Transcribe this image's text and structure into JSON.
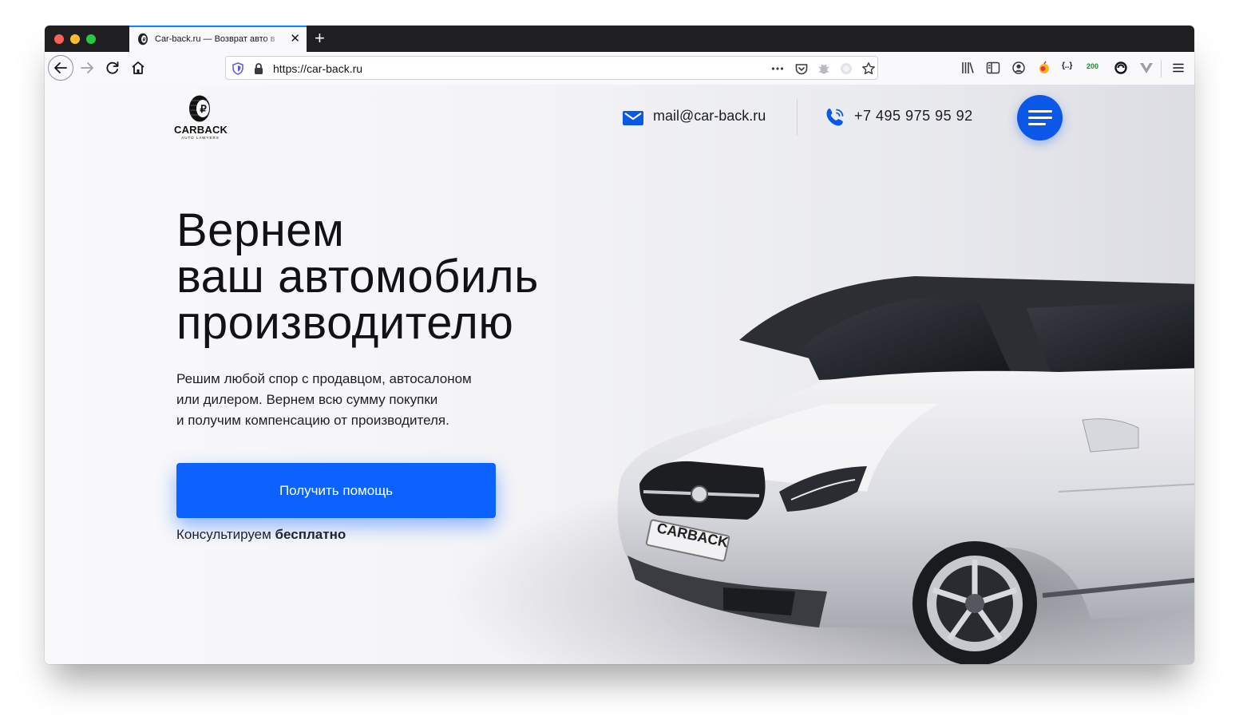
{
  "browser": {
    "tab_title": "Car-back.ru — Возврат авто в",
    "tab_close": "✕",
    "new_tab": "+",
    "url": "https://car-back.ru",
    "counter_badge": "200",
    "json_icon_label": "{..}"
  },
  "site": {
    "logo_word": "CARBACK",
    "logo_sub": "AUTO LAWYERS",
    "email": "mail@car-back.ru",
    "phone": "+7 495 975 95 92",
    "accent_color": "#0b62ff"
  },
  "hero": {
    "headline_lines": [
      "Вернем",
      "ваш автомобиль",
      "производителю"
    ],
    "sub_lines": [
      "Решим любой спор с продавцом, автосалоном",
      "или дилером. Вернем всю сумму покупки",
      "и получим компенсацию от производителя."
    ],
    "cta_label": "Получить помощь",
    "note_prefix": "Консультируем ",
    "note_bold": "бесплатно",
    "plate_text": "CARBACK"
  }
}
